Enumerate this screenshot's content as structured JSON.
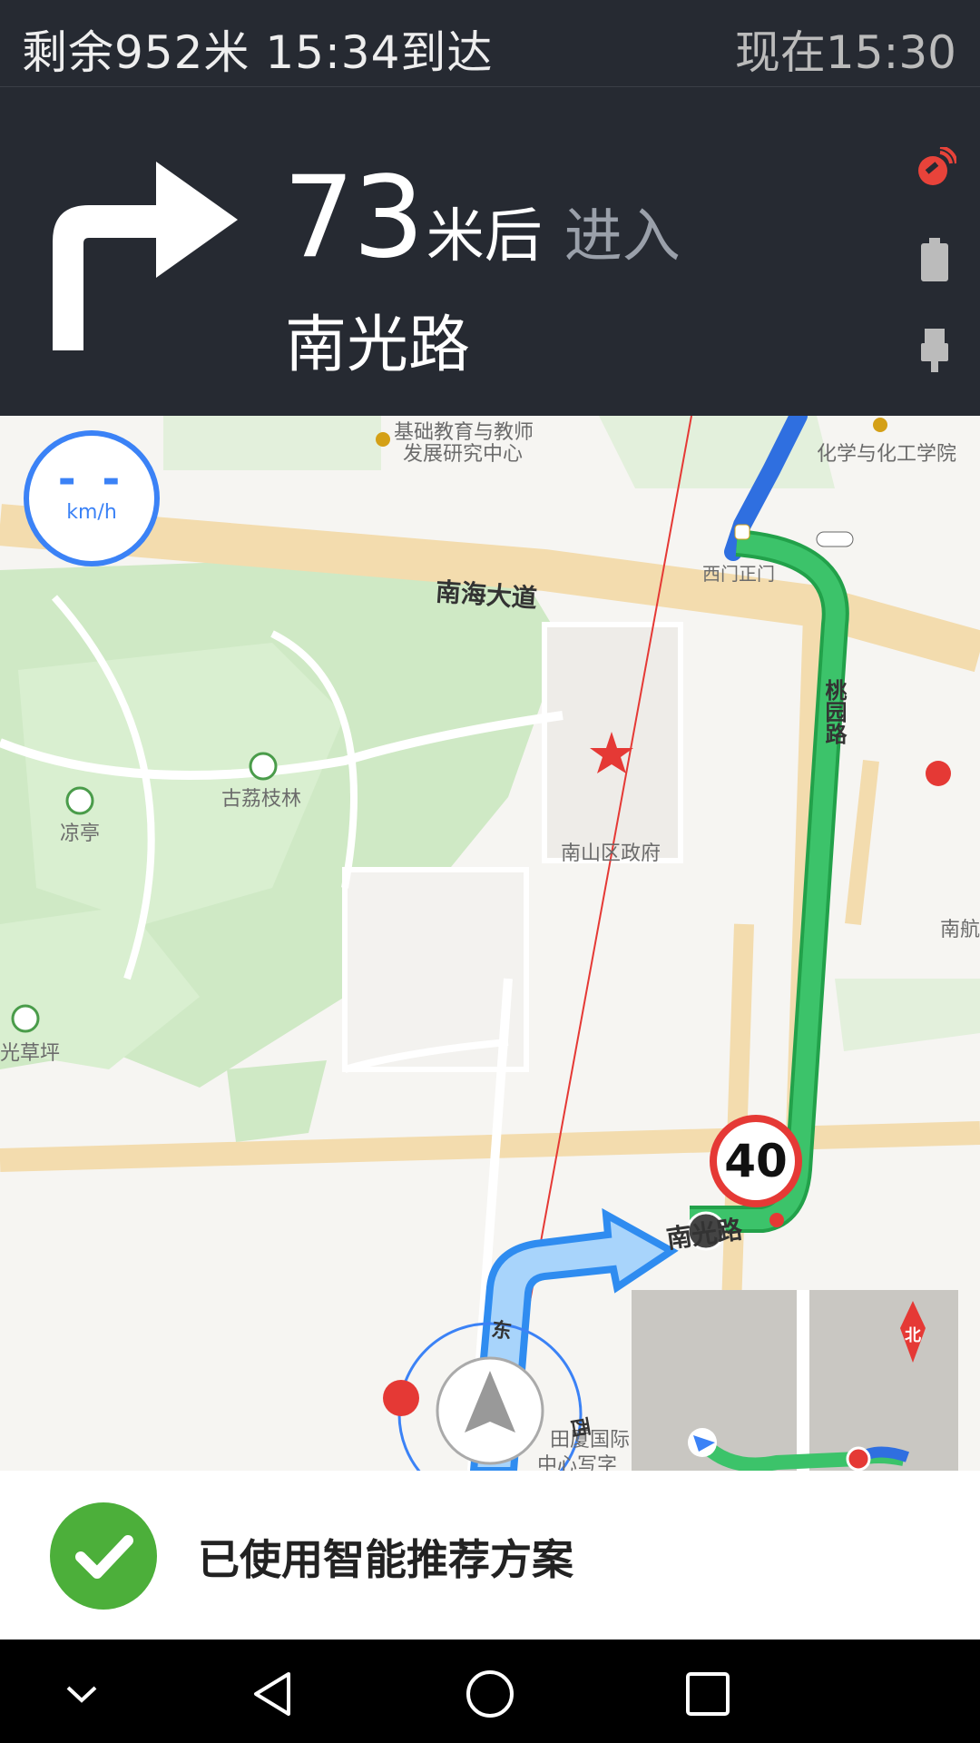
{
  "status": {
    "remaining": "剩余952米  15:34到达",
    "now": "现在15:30"
  },
  "guide": {
    "distance_number": "73",
    "distance_unit": "米后",
    "action": "进入",
    "road": "南光路"
  },
  "side_icons": [
    "gps-signal-icon",
    "battery-icon",
    "usb-icon",
    "mute-icon"
  ],
  "speedometer": {
    "value": "- -",
    "unit": "km/h"
  },
  "map": {
    "labels": [
      {
        "text": "基础教育与教师"
      },
      {
        "text": "发展研究中心"
      },
      {
        "text": "化学与化工学院"
      },
      {
        "text": "西门正门"
      },
      {
        "text": "古荔枝林"
      },
      {
        "text": "凉亭"
      },
      {
        "text": "南山区政府"
      },
      {
        "text": "南航"
      },
      {
        "text": "光草坪"
      },
      {
        "text": "田厦国际"
      },
      {
        "text": "中心写字"
      }
    ],
    "roads": [
      {
        "text": "南海大道"
      },
      {
        "text": "桃园路"
      },
      {
        "text": "南光路"
      },
      {
        "text": "东"
      },
      {
        "text": "西"
      }
    ],
    "speed_limit": "40",
    "compass": "北"
  },
  "banner": {
    "message": "已使用智能推荐方案"
  },
  "colors": {
    "route_green": "#3cc36a",
    "route_blue": "#3b82f6",
    "accent_red": "#e53935"
  }
}
